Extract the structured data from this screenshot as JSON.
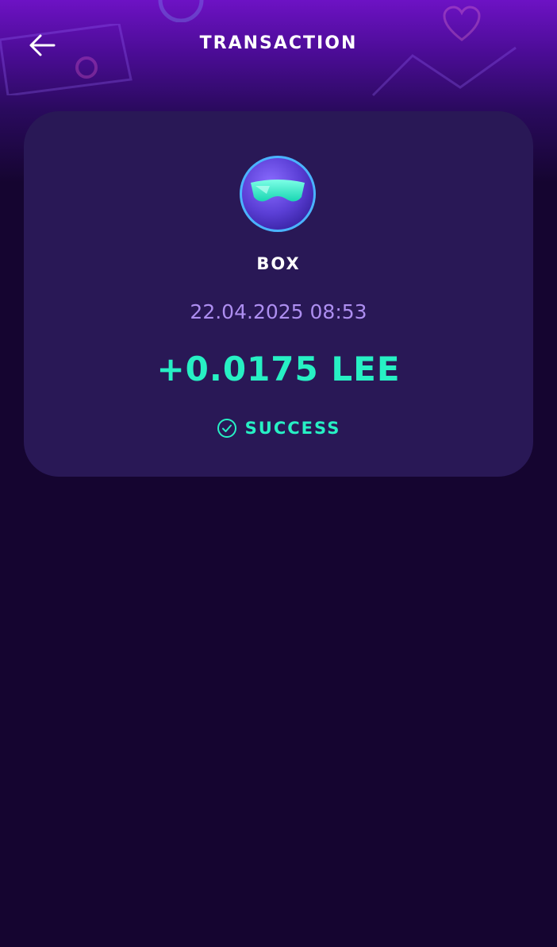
{
  "header": {
    "title": "TRANSACTION",
    "back_icon": "arrow-left-icon"
  },
  "transaction": {
    "item_name": "BOX",
    "avatar_icon": "goggles-avatar-icon",
    "datetime": "22.04.2025 08:53",
    "amount": "+0.0175 LEE",
    "status": "SUCCESS",
    "status_icon": "check-circle-icon"
  },
  "colors": {
    "background": "#150530",
    "header_purple": "#6d12c4",
    "card": "#291856",
    "accent": "#27f0c4",
    "date_text": "#ad8ef0"
  }
}
